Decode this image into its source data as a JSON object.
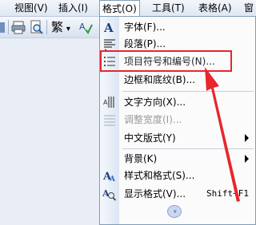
{
  "menubar": {
    "items": [
      "视图(V)",
      "插入(I)",
      "格式(O)",
      "工具(T)",
      "表格(A)",
      "窗"
    ]
  },
  "toolbar": {
    "traditional_label": "繁",
    "dropdown_symbol": "▾"
  },
  "format_menu": {
    "items": [
      {
        "label": "字体(F)...",
        "icon": "font-icon"
      },
      {
        "label": "段落(P)...",
        "icon": "paragraph-icon"
      },
      {
        "label": "项目符号和编号(N)...",
        "icon": "bullets-numbering-icon"
      },
      {
        "label": "边框和底纹(B)...",
        "icon": ""
      },
      {
        "label": "文字方向(X)...",
        "icon": "text-direction-icon"
      },
      {
        "label": "调整宽度(I)...",
        "icon": "fit-width-icon",
        "disabled": true
      },
      {
        "label": "中文版式(Y)",
        "icon": "",
        "submenu": true
      },
      {
        "label": "背景(K)",
        "icon": "",
        "submenu": true
      },
      {
        "label": "样式和格式(S)...",
        "icon": "styles-formatting-icon"
      },
      {
        "label": "显示格式(V)...",
        "icon": "reveal-formatting-icon",
        "shortcut": "Shift+F1"
      }
    ],
    "expand_symbol": "»"
  },
  "annotation": {
    "color": "#e8262d"
  }
}
